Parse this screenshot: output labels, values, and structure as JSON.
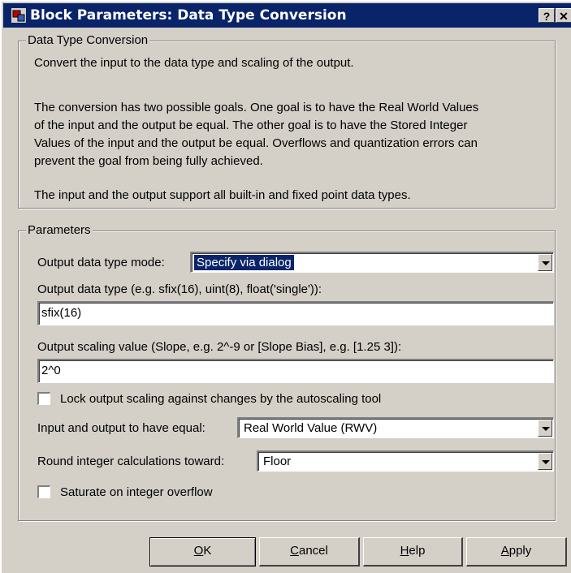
{
  "window": {
    "title": "Block Parameters: Data Type Conversion",
    "help_glyph": "?",
    "close_glyph": "✕"
  },
  "description": {
    "group_title": "Data Type Conversion",
    "lines": [
      "Convert the input to the data type and scaling of the output.",
      "The conversion has two possible goals. One goal is to have the Real World Values",
      "of the input and the output be equal.  The other goal is to have the Stored Integer",
      "Values of the input and the output be equal.  Overflows and quantization errors can",
      "prevent the goal from being fully achieved.",
      "The input and the output support all built-in and fixed point data types."
    ]
  },
  "parameters": {
    "group_title": "Parameters",
    "output_mode_label": "Output data type mode:",
    "output_mode_value": "Specify via dialog",
    "output_type_label": "Output data type (e.g. sfix(16), uint(8), float('single')):",
    "output_type_value": "sfix(16)",
    "scaling_label": "Output scaling value (Slope, e.g. 2^-9 or [Slope Bias], e.g. [1.25 3]):",
    "scaling_value": "2^0",
    "lock_label": "Lock output scaling against changes by the autoscaling tool",
    "lock_checked": false,
    "equal_label": "Input and output to have equal:",
    "equal_value": "Real World Value (RWV)",
    "round_label": "Round integer calculations toward:",
    "round_value": "Floor",
    "saturate_label": "Saturate on integer overflow",
    "saturate_checked": false
  },
  "buttons": {
    "ok_mnemonic": "O",
    "ok_rest": "K",
    "cancel_mnemonic": "C",
    "cancel_rest": "ancel",
    "help_mnemonic": "H",
    "help_rest": "elp",
    "apply_mnemonic": "A",
    "apply_rest": "pply"
  },
  "colors": {
    "titlebar": "#0a246a",
    "face": "#d4d0c8",
    "selection": "#0a246a"
  }
}
